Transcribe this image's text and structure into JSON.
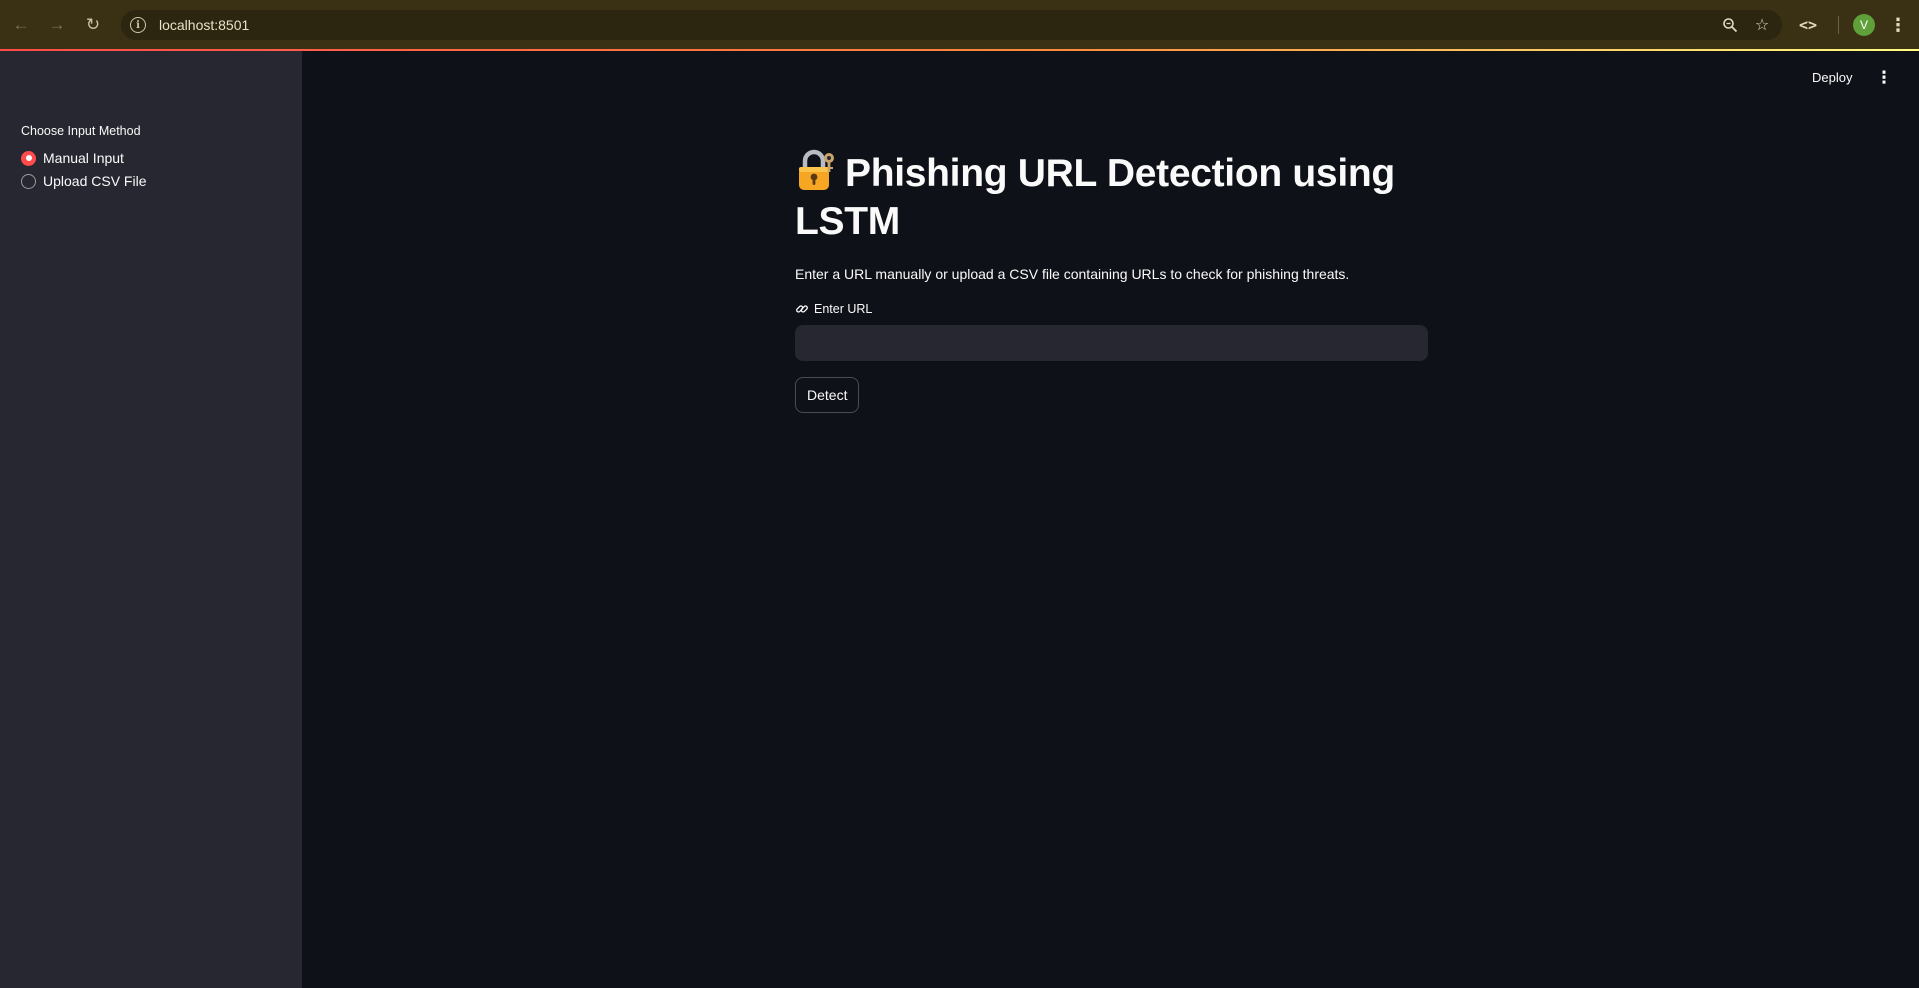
{
  "browser": {
    "url": "localhost:8501",
    "avatar_initial": "V",
    "icons": {
      "back": "arrow-left-icon",
      "forward": "arrow-right-icon",
      "reload": "reload-icon",
      "site_info": "info-icon",
      "zoom": "zoom-icon",
      "bookmark": "star-icon",
      "devtools": "code-icon",
      "menu": "kebab-menu-icon"
    },
    "colors": {
      "toolbar": "#3a3114",
      "accent_line_start": "#ff4b4b",
      "accent_line_end": "#fffd80",
      "avatar": "#5fa03a"
    }
  },
  "header": {
    "deploy_label": "Deploy",
    "menu_icon": "kebab-menu-icon"
  },
  "sidebar": {
    "radio_label": "Choose Input Method",
    "options": [
      {
        "label": "Manual Input",
        "selected": true
      },
      {
        "label": "Upload CSV File",
        "selected": false
      }
    ]
  },
  "main": {
    "title_icon": "lock-with-key-icon",
    "title": "Phishing URL Detection using LSTM",
    "description": "Enter a URL manually or upload a CSV file containing URLs to check for phishing threats.",
    "url_field": {
      "label": "Enter URL",
      "label_icon": "link-icon",
      "value": "",
      "placeholder": ""
    },
    "detect_button": "Detect"
  },
  "theme": {
    "background": "#0e1117",
    "sidebar_background": "#262730",
    "primary": "#ff4b4b",
    "text": "#fafafa"
  }
}
